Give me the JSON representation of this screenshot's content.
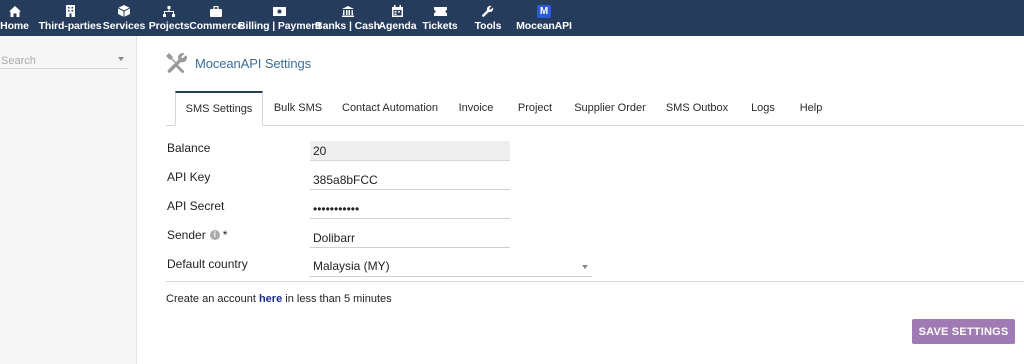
{
  "topnav": {
    "items": [
      {
        "label": "Home",
        "icon": "home-icon"
      },
      {
        "label": "Third-parties",
        "icon": "building-icon"
      },
      {
        "label": "Services",
        "icon": "cube-icon"
      },
      {
        "label": "Projects",
        "icon": "sitemap-icon"
      },
      {
        "label": "Commerce",
        "icon": "briefcase-icon"
      },
      {
        "label": "Billing | Payment",
        "icon": "money-icon"
      },
      {
        "label": "Banks | Cash",
        "icon": "bank-icon"
      },
      {
        "label": "Agenda",
        "icon": "calendar-icon"
      },
      {
        "label": "Tickets",
        "icon": "ticket-icon"
      },
      {
        "label": "Tools",
        "icon": "wrench-icon"
      },
      {
        "label": "MoceanAPI",
        "icon": "moceanapi-logo-icon",
        "badge": "M"
      }
    ],
    "color": "#263c5c"
  },
  "sidebar": {
    "search_placeholder": "Search"
  },
  "page": {
    "title": "MoceanAPI Settings",
    "title_icon": "tools-icon"
  },
  "tabs": [
    {
      "label": "SMS Settings",
      "active": true
    },
    {
      "label": "Bulk SMS"
    },
    {
      "label": "Contact Automation"
    },
    {
      "label": "Invoice"
    },
    {
      "label": "Project"
    },
    {
      "label": "Supplier Order"
    },
    {
      "label": "SMS Outbox"
    },
    {
      "label": "Logs"
    },
    {
      "label": "Help"
    }
  ],
  "form": {
    "balance_label": "Balance",
    "balance_value": "20",
    "api_key_label": "API Key",
    "api_key_value": "385a8bFCC",
    "api_secret_label": "API Secret",
    "api_secret_value": "•••••••••••",
    "sender_label": "Sender",
    "sender_required": "*",
    "sender_value": "Dolibarr",
    "country_label": "Default country",
    "country_value": "Malaysia (MY)"
  },
  "footer": {
    "create_prefix": "Create an account ",
    "create_link": "here",
    "create_suffix": " in less than 5 minutes",
    "save_label": "SAVE SETTINGS",
    "save_color": "#a07ab3"
  }
}
